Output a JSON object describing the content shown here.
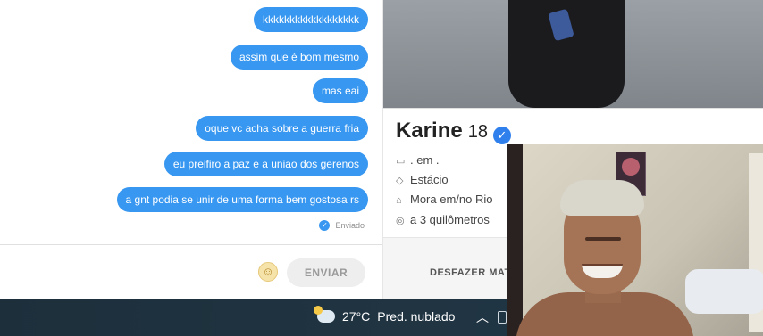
{
  "chat": {
    "messages": [
      "kkkkkkkkkkkkkkkkkk",
      "assim que é bom mesmo",
      "mas eai",
      "oque vc acha sobre a guerra fria",
      "eu preifiro a paz e a uniao dos gerenos",
      "a gnt podia se unir de uma forma bem gostosa rs"
    ],
    "sent_status": "Enviado",
    "send_label": "ENVIAR",
    "emoji_icon": "smiley-emoji-icon",
    "bubble_color": "#3897f0"
  },
  "profile": {
    "name": "Karine",
    "age": "18",
    "verified_icon": "verified-check-icon",
    "details": [
      {
        "icon": "briefcase-icon",
        "text": ". em ."
      },
      {
        "icon": "graduation-cap-icon",
        "text": "Estácio"
      },
      {
        "icon": "home-icon",
        "text": "Mora em/no Rio"
      },
      {
        "icon": "location-pin-icon",
        "text": "a 3 quilômetros"
      }
    ],
    "undo_label": "DESFAZER MAT"
  },
  "taskbar": {
    "temperature": "27°C",
    "weather_text": "Pred. nublado",
    "weather_icon": "partly-cloudy-icon",
    "tray_chevron": "^"
  }
}
